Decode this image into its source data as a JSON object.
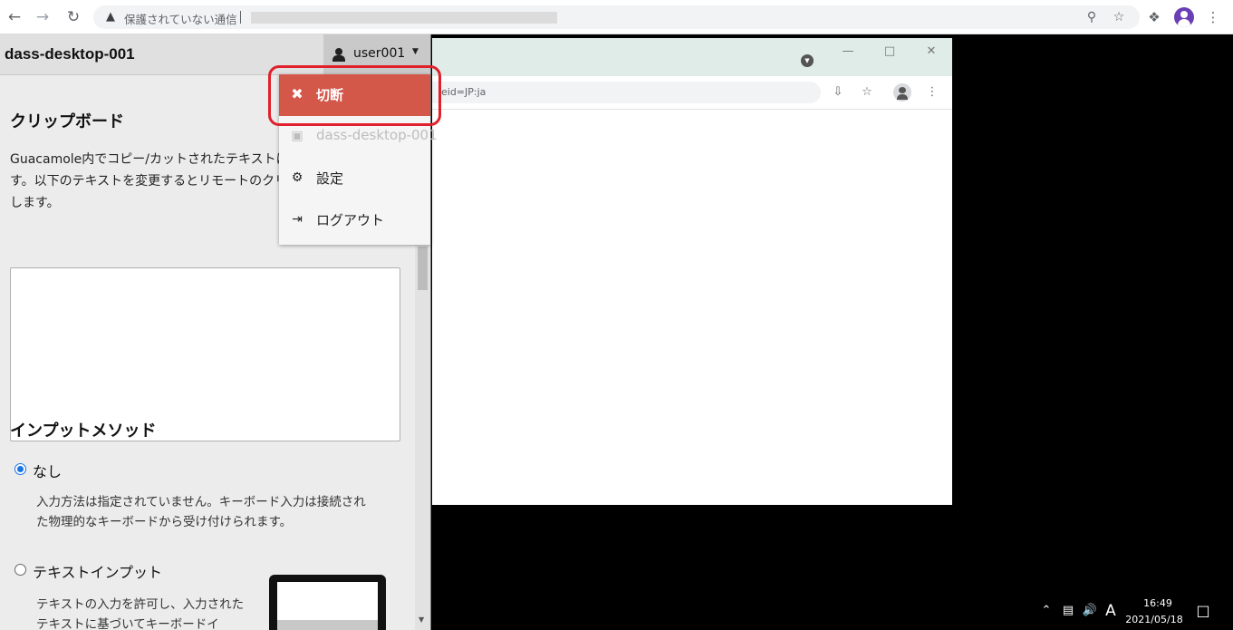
{
  "browser": {
    "security_text": "保護されていない通信",
    "icons": [
      "back-icon",
      "forward-icon",
      "reload-icon",
      "warning-icon",
      "key-icon",
      "star-icon",
      "extensions-icon",
      "profile-icon",
      "more-icon"
    ]
  },
  "guac": {
    "connection_name": "dass-desktop-001",
    "username": "user001",
    "menu": {
      "disconnect": "切断",
      "desktop": "dass-desktop-001",
      "settings": "設定",
      "logout": "ログアウト"
    },
    "clipboard": {
      "title": "クリップボード",
      "description": "Guacamole内でコピー/カットされたテキストはここに表示されます。以下のテキストを変更するとリモートのクリップボードに影響します。",
      "value": ""
    },
    "input_method": {
      "title": "インプットメソッド",
      "options": [
        {
          "label": "なし",
          "checked": true,
          "description": "入力方法は指定されていません。キーボード入力は接続された物理的なキーボードから受け付けられます。"
        },
        {
          "label": "テキストインプット",
          "checked": false,
          "description": "テキストの入力を許可し、入力されたテキストに基づいてキーボードイ"
        }
      ]
    }
  },
  "remote_window": {
    "url_fragment": "eid=JP:ja"
  },
  "taskbar": {
    "ime": "A",
    "time": "16:49",
    "date": "2021/05/18"
  }
}
